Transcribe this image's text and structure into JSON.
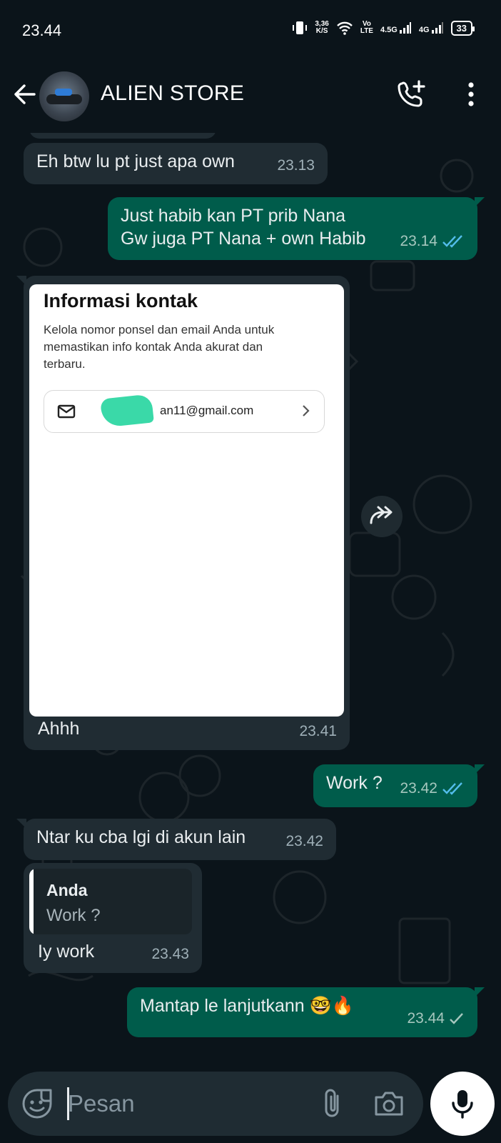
{
  "status": {
    "time": "23.44",
    "net_speed_value": "3,36",
    "net_speed_unit": "K/S",
    "volte_top": "Vo",
    "volte_bottom": "LTE",
    "net1": "4.5G",
    "net2": "4G",
    "battery": "33"
  },
  "header": {
    "contact_name": "ALIEN STORE"
  },
  "messages": [
    {
      "text": "Eh btw lu pt just apa own",
      "time": "23.13"
    },
    {
      "line1": "Just habib kan PT prib Nana",
      "line2": "Gw juga PT Nana + own Habib",
      "time": "23.14"
    },
    {
      "image": {
        "title": "Informasi kontak",
        "description": "Kelola nomor ponsel dan email Anda untuk memastikan info kontak Anda akurat dan terbaru.",
        "email": "an11@gmail.com"
      },
      "text": "Ahhh",
      "time": "23.41"
    },
    {
      "text": "Work ?",
      "time": "23.42"
    },
    {
      "text": "Ntar ku cba lgi di akun lain",
      "time": "23.42"
    },
    {
      "quote_author": "Anda",
      "quote_text": "Work ?",
      "text": "Iy work",
      "time": "23.43"
    },
    {
      "text": "Mantap le lanjutkann 🤓🔥",
      "time": "23.44"
    }
  ],
  "composer": {
    "placeholder": "Pesan"
  },
  "colors": {
    "background": "#0b141a",
    "incoming_bubble": "#202c33",
    "outgoing_bubble": "#005c4b",
    "read_tick": "#53bdeb",
    "input_bg": "#1f2c33"
  },
  "icons": [
    "back-arrow-icon",
    "add-call-icon",
    "more-vert-icon",
    "forward-icon",
    "double-check-icon",
    "single-check-icon",
    "sticker-icon",
    "attach-icon",
    "camera-icon",
    "mic-icon",
    "mail-icon",
    "chevron-right-icon"
  ]
}
